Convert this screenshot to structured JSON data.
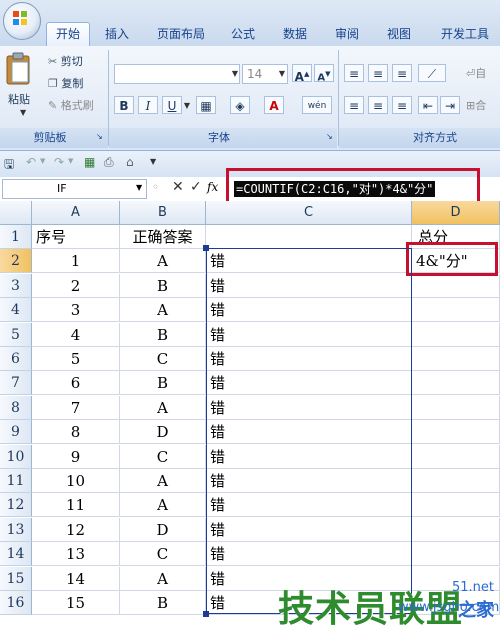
{
  "ribbon": {
    "tabs": [
      "开始",
      "插入",
      "页面布局",
      "公式",
      "数据",
      "审阅",
      "视图",
      "开发工具"
    ],
    "active_tab": "开始",
    "clipboard": {
      "paste": "粘贴",
      "cut": "剪切",
      "copy": "复制",
      "format_painter": "格式刷",
      "group_label": "剪贴板"
    },
    "font": {
      "font_name": "",
      "font_size": "14",
      "grow": "A",
      "shrink": "A",
      "bold": "B",
      "italic": "I",
      "underline": "U",
      "phonetic": "wén",
      "group_label": "字体"
    },
    "alignment": {
      "group_label": "对齐方式",
      "wrap_label": "自",
      "merge_label": "合"
    }
  },
  "formula_bar": {
    "name_box": "IF",
    "fx": "fx",
    "formula": "=COUNTIF(C2:C16,\"对\")*4&\"分\""
  },
  "sheet": {
    "columns": [
      "A",
      "B",
      "C",
      "D"
    ],
    "selected_column": "D",
    "selected_row": 2,
    "row_numbers": [
      1,
      2,
      3,
      4,
      5,
      6,
      7,
      8,
      9,
      10,
      11,
      12,
      13,
      14,
      15,
      16
    ],
    "header": {
      "A": "序号",
      "B": "正确答案",
      "C": "",
      "D": "总分"
    },
    "editing_cell_text": "4&\"分\"",
    "rows": [
      {
        "a": "1",
        "b": "A",
        "c": "错"
      },
      {
        "a": "2",
        "b": "B",
        "c": "错"
      },
      {
        "a": "3",
        "b": "A",
        "c": "错"
      },
      {
        "a": "4",
        "b": "B",
        "c": "错"
      },
      {
        "a": "5",
        "b": "C",
        "c": "错"
      },
      {
        "a": "6",
        "b": "B",
        "c": "错"
      },
      {
        "a": "7",
        "b": "A",
        "c": "错"
      },
      {
        "a": "8",
        "b": "D",
        "c": "错"
      },
      {
        "a": "9",
        "b": "C",
        "c": "错"
      },
      {
        "a": "10",
        "b": "A",
        "c": "错"
      },
      {
        "a": "11",
        "b": "A",
        "c": "错"
      },
      {
        "a": "12",
        "b": "D",
        "c": "错"
      },
      {
        "a": "13",
        "b": "C",
        "c": "错"
      },
      {
        "a": "14",
        "b": "A",
        "c": "错"
      },
      {
        "a": "15",
        "b": "B",
        "c": "错"
      }
    ]
  },
  "watermark": {
    "brand": "技术员联盟",
    "site": "www.jsgho.com",
    "suffix": "51.net",
    "suffix2": "之家"
  },
  "colors": {
    "highlight_box": "#c8102e",
    "ribbon_text": "#15428b",
    "selected_header": "#f1c15f"
  }
}
